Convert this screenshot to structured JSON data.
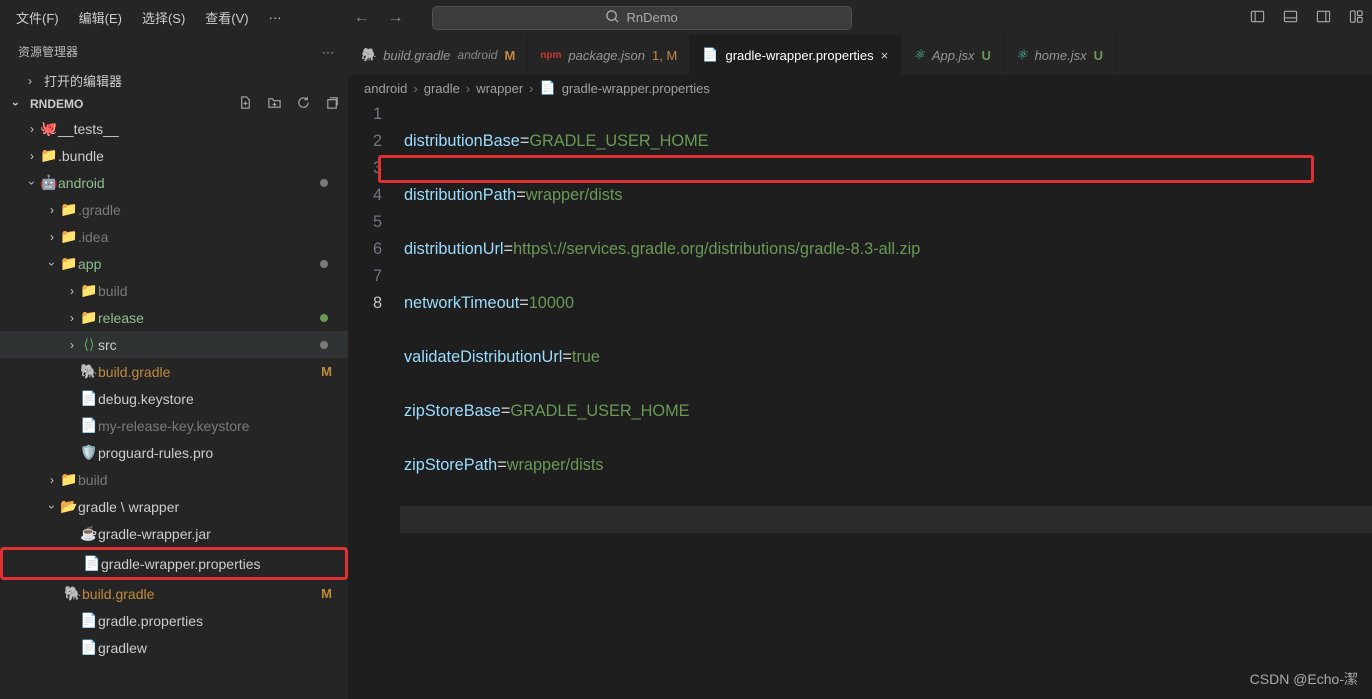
{
  "menu": {
    "file": "文件(F)",
    "edit": "编辑(E)",
    "select": "选择(S)",
    "view": "查看(V)",
    "more": "···"
  },
  "search": {
    "placeholder": "RnDemo"
  },
  "sidebar": {
    "title": "资源管理器",
    "open_editors": "打开的编辑器",
    "project": "RNDEMO"
  },
  "tree": {
    "tests": "__tests__",
    "bundle": ".bundle",
    "android": "android",
    "gradle": ".gradle",
    "idea": ".idea",
    "app": "app",
    "build": "build",
    "release": "release",
    "src": "src",
    "build_gradle": "build.gradle",
    "debug_keystore": "debug.keystore",
    "my_release_key": "my-release-key.keystore",
    "proguard": "proguard-rules.pro",
    "build2": "build",
    "gradle_wrapper": "gradle \\ wrapper",
    "gradle_wrapper_jar": "gradle-wrapper.jar",
    "gradle_wrapper_props": "gradle-wrapper.properties",
    "build_gradle2": "build.gradle",
    "gradle_properties": "gradle.properties",
    "gradlew": "gradlew"
  },
  "tabs": [
    {
      "label": "build.gradle",
      "sublabel": "android",
      "status": "M",
      "type": "gradle"
    },
    {
      "label": "package.json",
      "status": "1, M",
      "type": "npm"
    },
    {
      "label": "gradle-wrapper.properties",
      "status": "×",
      "type": "file",
      "active": true
    },
    {
      "label": "App.jsx",
      "status": "U",
      "type": "react"
    },
    {
      "label": "home.jsx",
      "status": "U",
      "type": "react"
    }
  ],
  "breadcrumb": [
    "android",
    "gradle",
    "wrapper",
    "gradle-wrapper.properties"
  ],
  "code": {
    "lines": [
      {
        "n": "1",
        "k": "distributionBase",
        "v": "GRADLE_USER_HOME"
      },
      {
        "n": "2",
        "k": "distributionPath",
        "v": "wrapper/dists"
      },
      {
        "n": "3",
        "k": "distributionUrl",
        "v": "https\\://services.gradle.org/distributions/gradle-8.3-all.zip"
      },
      {
        "n": "4",
        "k": "networkTimeout",
        "v": "10000"
      },
      {
        "n": "5",
        "k": "validateDistributionUrl",
        "v": "true"
      },
      {
        "n": "6",
        "k": "zipStoreBase",
        "v": "GRADLE_USER_HOME"
      },
      {
        "n": "7",
        "k": "zipStorePath",
        "v": "wrapper/dists"
      },
      {
        "n": "8",
        "k": "",
        "v": ""
      }
    ]
  },
  "watermark": "CSDN @Echo-潔"
}
